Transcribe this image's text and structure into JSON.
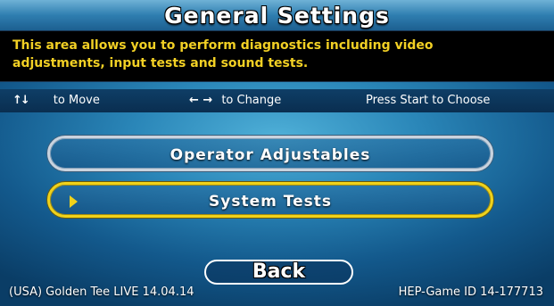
{
  "title": "General Settings",
  "description": {
    "line1": "This area allows you to perform diagnostics including video",
    "line2": "adjustments, input tests and sound tests."
  },
  "help_bar": {
    "move_icon": "up-down-arrows-icon",
    "move_glyph": "↑↓",
    "move_label": "to Move",
    "change_icon": "left-right-arrows-icon",
    "change_glyph": "← →",
    "change_label": "to Change",
    "choose_label": "Press Start to Choose"
  },
  "menu": {
    "items": [
      {
        "label": "Operator Adjustables",
        "selected": false
      },
      {
        "label": "System Tests",
        "selected": true
      }
    ],
    "cursor_icon": "selection-arrow-icon",
    "back_label": "Back"
  },
  "footer": {
    "version": "(USA) Golden Tee LIVE 14.04.14",
    "game_id": "HEP-Game ID 14-177713"
  },
  "colors": {
    "accent": "#f0d21a",
    "description_text": "#f2d024",
    "background": "#2a86b8"
  }
}
